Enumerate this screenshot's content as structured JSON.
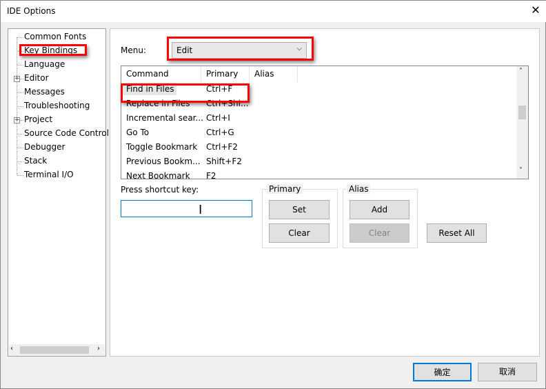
{
  "window": {
    "title": "IDE Options",
    "close_icon": "close-icon"
  },
  "tree": {
    "items": [
      {
        "label": "Common Fonts",
        "expandable": false
      },
      {
        "label": "Key Bindings",
        "expandable": false,
        "selected": true
      },
      {
        "label": "Language",
        "expandable": false
      },
      {
        "label": "Editor",
        "expandable": true
      },
      {
        "label": "Messages",
        "expandable": false
      },
      {
        "label": "Troubleshooting",
        "expandable": false
      },
      {
        "label": "Project",
        "expandable": true
      },
      {
        "label": "Source Code Control",
        "expandable": false
      },
      {
        "label": "Debugger",
        "expandable": false
      },
      {
        "label": "Stack",
        "expandable": false
      },
      {
        "label": "Terminal I/O",
        "expandable": false
      }
    ]
  },
  "menu": {
    "label": "Menu:",
    "value": "Edit"
  },
  "table": {
    "columns": [
      "Command",
      "Primary",
      "Alias"
    ],
    "rows": [
      [
        "Find in Files",
        "Ctrl+F",
        ""
      ],
      [
        "Replace in Files",
        "Ctrl+Shi...",
        ""
      ],
      [
        "Incremental sear...",
        "Ctrl+I",
        ""
      ],
      [
        "Go To",
        "Ctrl+G",
        ""
      ],
      [
        "Toggle Bookmark",
        "Ctrl+F2",
        ""
      ],
      [
        "Previous Bookm...",
        "Shift+F2",
        ""
      ],
      [
        "Next Bookmark",
        "F2",
        ""
      ]
    ]
  },
  "shortcut": {
    "label": "Press shortcut key:",
    "value": ""
  },
  "primary": {
    "label": "Primary",
    "set": "Set",
    "clear": "Clear"
  },
  "alias": {
    "label": "Alias",
    "add": "Add",
    "clear": "Clear"
  },
  "reset_all": "Reset All",
  "footer": {
    "ok": "确定",
    "cancel": "取消"
  },
  "colors": {
    "highlight": "#ff0000",
    "focus": "#0078d7"
  }
}
